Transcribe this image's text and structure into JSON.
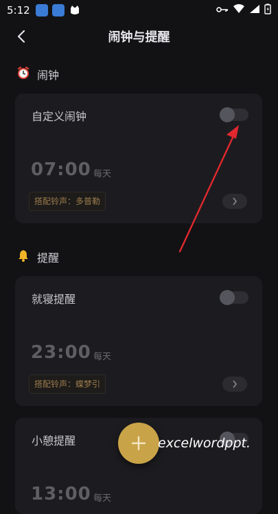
{
  "status_bar": {
    "time": "5:12"
  },
  "header": {
    "title": "闹钟与提醒"
  },
  "sections": [
    {
      "label": "闹钟",
      "icon": "alarm-clock-icon"
    },
    {
      "label": "提醒",
      "icon": "bell-icon"
    }
  ],
  "cards": [
    {
      "name": "自定义闹钟",
      "time": "07:00",
      "repeat": "每天",
      "ringtone": "搭配铃声：多普勒",
      "enabled": false
    },
    {
      "name": "就寝提醒",
      "time": "23:00",
      "repeat": "每天",
      "ringtone": "搭配铃声：蝶梦引",
      "enabled": false
    },
    {
      "name": "小憩提醒",
      "time": "13:00",
      "repeat": "每天",
      "enabled": false
    }
  ],
  "watermark": "excelwordppt.",
  "colors": {
    "background": "#121214",
    "card": "#1c1c20",
    "accent": "#c9a348",
    "arrow": "#e0282e"
  }
}
